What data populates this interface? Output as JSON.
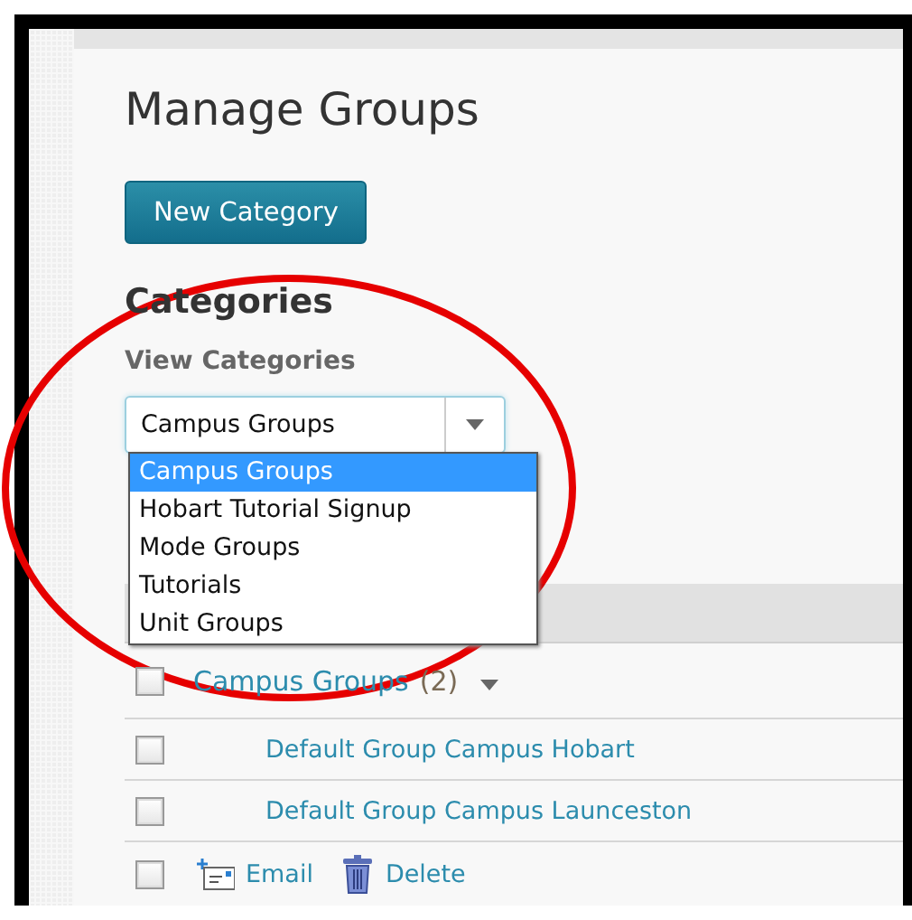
{
  "page": {
    "title": "Manage Groups"
  },
  "new_button": "New Category",
  "section_title": "Categories",
  "view_label": "View Categories",
  "select": {
    "value": "Campus Groups",
    "expanded": true,
    "options": [
      {
        "label": "Campus Groups",
        "selected": true
      },
      {
        "label": "Hobart Tutorial Signup",
        "selected": false
      },
      {
        "label": "Mode Groups",
        "selected": false
      },
      {
        "label": "Tutorials",
        "selected": false
      },
      {
        "label": "Unit Groups",
        "selected": false
      }
    ]
  },
  "groups": [
    {
      "name": "Campus Groups",
      "count": "(2)",
      "checked": false,
      "expanded": true,
      "members": [
        {
          "name": "Default Group Campus Hobart",
          "checked": false
        },
        {
          "name": "Default Group Campus Launceston",
          "checked": false
        }
      ]
    }
  ],
  "action_bar": {
    "checked": false,
    "actions": [
      {
        "kind": "email",
        "label": "Email"
      },
      {
        "kind": "delete",
        "label": "Delete"
      }
    ]
  },
  "annotation": {
    "kind": "circle"
  }
}
